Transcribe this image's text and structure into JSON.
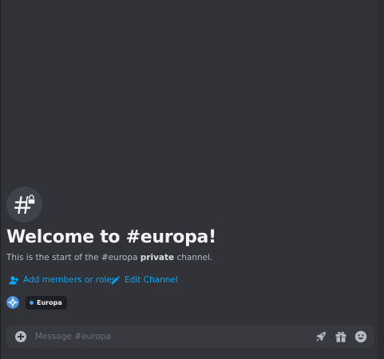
{
  "channel": {
    "icon": "hashtag-lock-icon",
    "welcome_title": "Welcome to #europa!",
    "intro_prefix": "This is the start of the #europa ",
    "intro_emphasis": "private",
    "intro_suffix": " channel."
  },
  "actions": {
    "add_members": {
      "icon": "add-member-icon",
      "label": "Add members or roles"
    },
    "edit_channel": {
      "icon": "pencil-icon",
      "label": "Edit Channel"
    }
  },
  "roles": [
    {
      "name": "Europa",
      "color": "#3ba0ff"
    }
  ],
  "composer": {
    "placeholder": "Message #europa",
    "value": "",
    "icons": [
      "plus-circle-icon",
      "boost-rocket-icon",
      "gift-icon",
      "emoji-icon"
    ]
  },
  "colors": {
    "background": "#313338",
    "link": "#00a8fc",
    "composer_bg": "#383a40"
  }
}
